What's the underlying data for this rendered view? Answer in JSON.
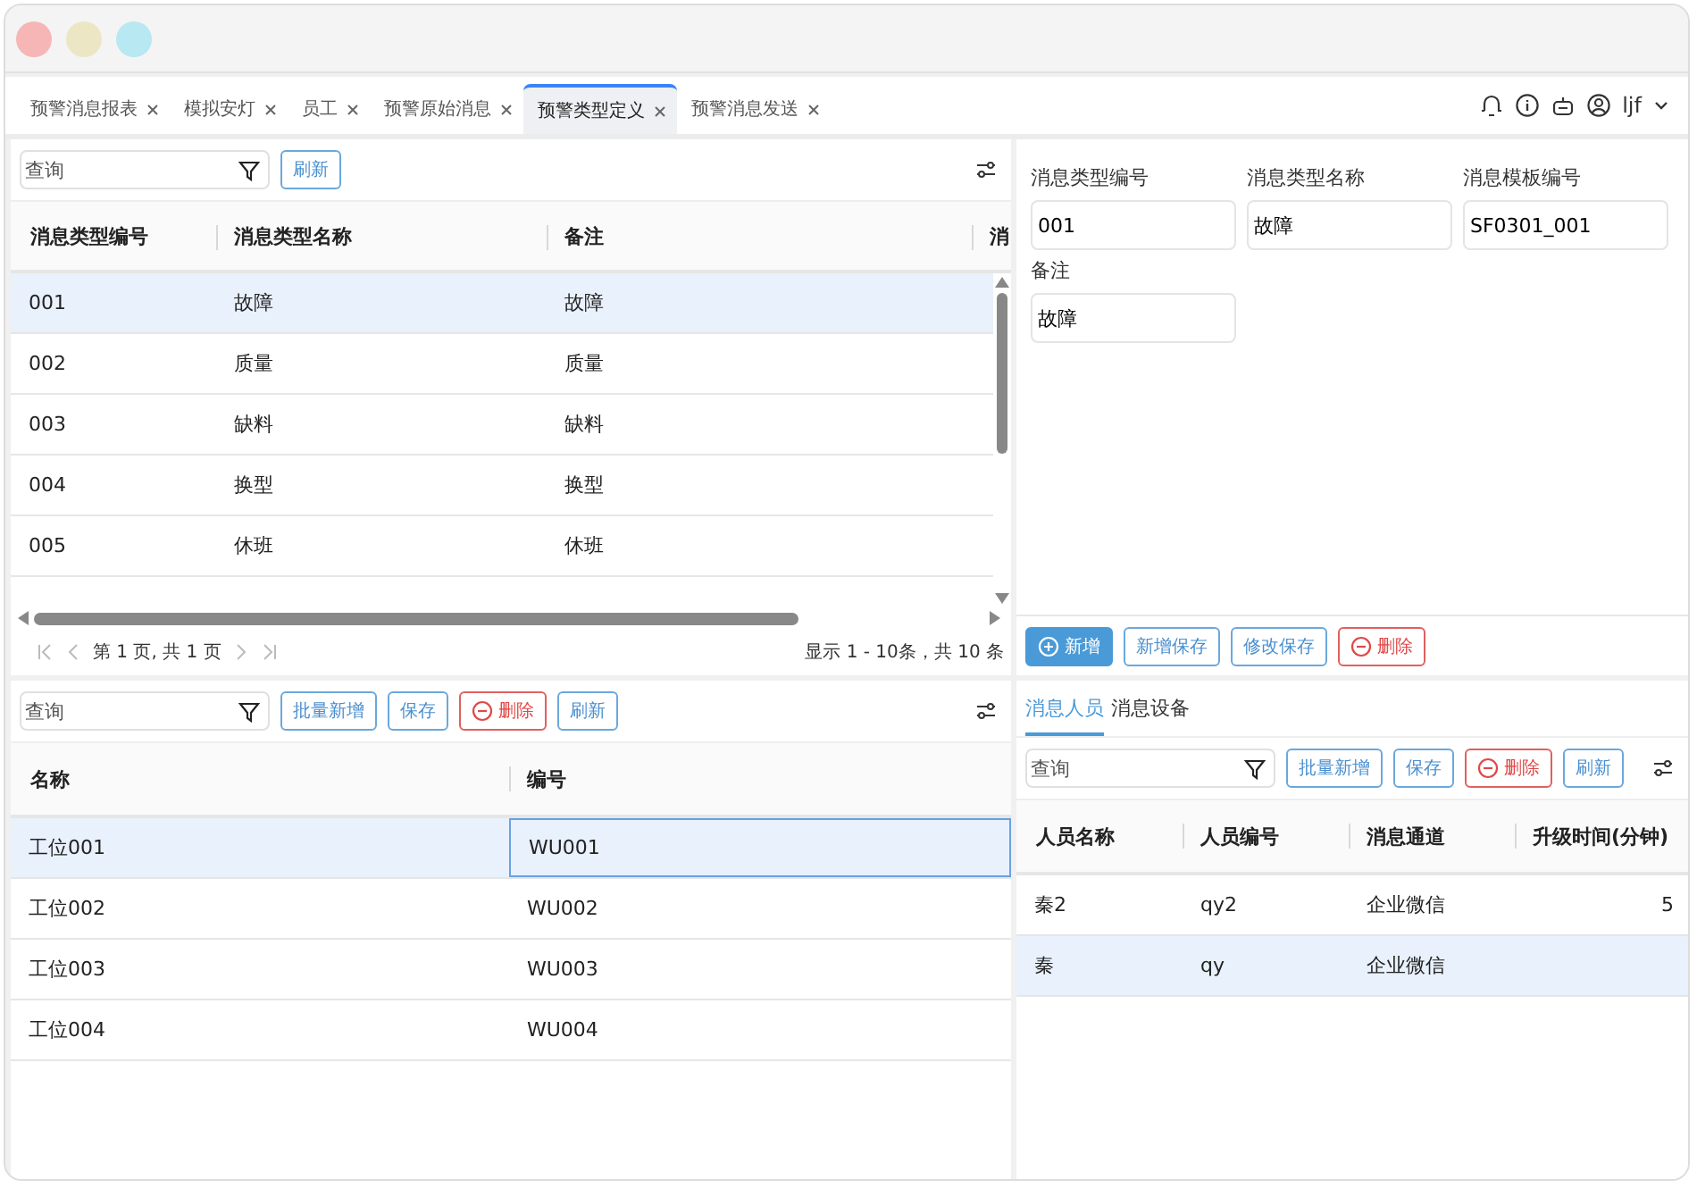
{
  "tabs": [
    {
      "label": "预警消息报表",
      "selected": false
    },
    {
      "label": "模拟安灯",
      "selected": false
    },
    {
      "label": "员工",
      "selected": false
    },
    {
      "label": "预警原始消息",
      "selected": false
    },
    {
      "label": "预警类型定义",
      "selected": true
    },
    {
      "label": "预警消息发送",
      "selected": false
    }
  ],
  "user": {
    "name": "ljf"
  },
  "type_list": {
    "search": {
      "placeholder": "查询"
    },
    "buttons": [
      {
        "label": "刷新",
        "kind": "outline"
      }
    ],
    "columns": [
      "消息类型编号",
      "消息类型名称",
      "备注",
      "消"
    ],
    "rows": [
      {
        "cells": [
          "001",
          "故障",
          "故障"
        ],
        "selected": true
      },
      {
        "cells": [
          "002",
          "质量",
          "质量"
        ],
        "selected": false
      },
      {
        "cells": [
          "003",
          "缺料",
          "缺料"
        ],
        "selected": false
      },
      {
        "cells": [
          "004",
          "换型",
          "换型"
        ],
        "selected": false
      },
      {
        "cells": [
          "005",
          "休班",
          "休班"
        ],
        "selected": false
      }
    ],
    "pager": {
      "page_text": "第 1 页, 共 1 页",
      "summary": "显示 1 - 10条，共 10 条"
    }
  },
  "detail_form": {
    "fields": [
      {
        "label": "消息类型编号",
        "value": "001"
      },
      {
        "label": "消息类型名称",
        "value": "故障"
      },
      {
        "label": "消息模板编号",
        "value": "SF0301_001"
      },
      {
        "label": "备注",
        "value": "故障"
      }
    ],
    "buttons": [
      {
        "label": "新增",
        "kind": "primary"
      },
      {
        "label": "新增保存",
        "kind": "outline"
      },
      {
        "label": "修改保存",
        "kind": "outline"
      },
      {
        "label": "删除",
        "kind": "danger"
      }
    ]
  },
  "workstations": {
    "search": {
      "placeholder": "查询"
    },
    "buttons": [
      {
        "label": "批量新增",
        "kind": "outline"
      },
      {
        "label": "保存",
        "kind": "outline"
      },
      {
        "label": "删除",
        "kind": "danger"
      },
      {
        "label": "刷新",
        "kind": "outline"
      }
    ],
    "columns": [
      "名称",
      "编号"
    ],
    "rows": [
      {
        "cells": [
          {
            "text": "工位001",
            "focused": false
          },
          {
            "text": "WU001",
            "focused": true
          }
        ],
        "selected": true
      },
      {
        "cells": [
          {
            "text": "工位002",
            "focused": false
          },
          {
            "text": "WU002",
            "focused": false
          }
        ],
        "selected": false
      },
      {
        "cells": [
          {
            "text": "工位003",
            "focused": false
          },
          {
            "text": "WU003",
            "focused": false
          }
        ],
        "selected": false
      },
      {
        "cells": [
          {
            "text": "工位004",
            "focused": false
          },
          {
            "text": "WU004",
            "focused": false
          }
        ],
        "selected": false
      }
    ]
  },
  "recipients": {
    "tabs": [
      {
        "label": "消息人员",
        "selected": true
      },
      {
        "label": "消息设备",
        "selected": false
      }
    ],
    "search": {
      "placeholder": "查询"
    },
    "buttons": [
      {
        "label": "批量新增",
        "kind": "outline"
      },
      {
        "label": "保存",
        "kind": "outline"
      },
      {
        "label": "删除",
        "kind": "danger"
      },
      {
        "label": "刷新",
        "kind": "outline"
      }
    ],
    "columns": [
      "人员名称",
      "人员编号",
      "消息通道",
      "升级时间(分钟)"
    ],
    "rows": [
      {
        "cells": [
          "秦2",
          "qy2",
          "企业微信",
          "5"
        ],
        "selected": false
      },
      {
        "cells": [
          "秦",
          "qy",
          "企业微信"
        ],
        "selected": true
      }
    ]
  }
}
